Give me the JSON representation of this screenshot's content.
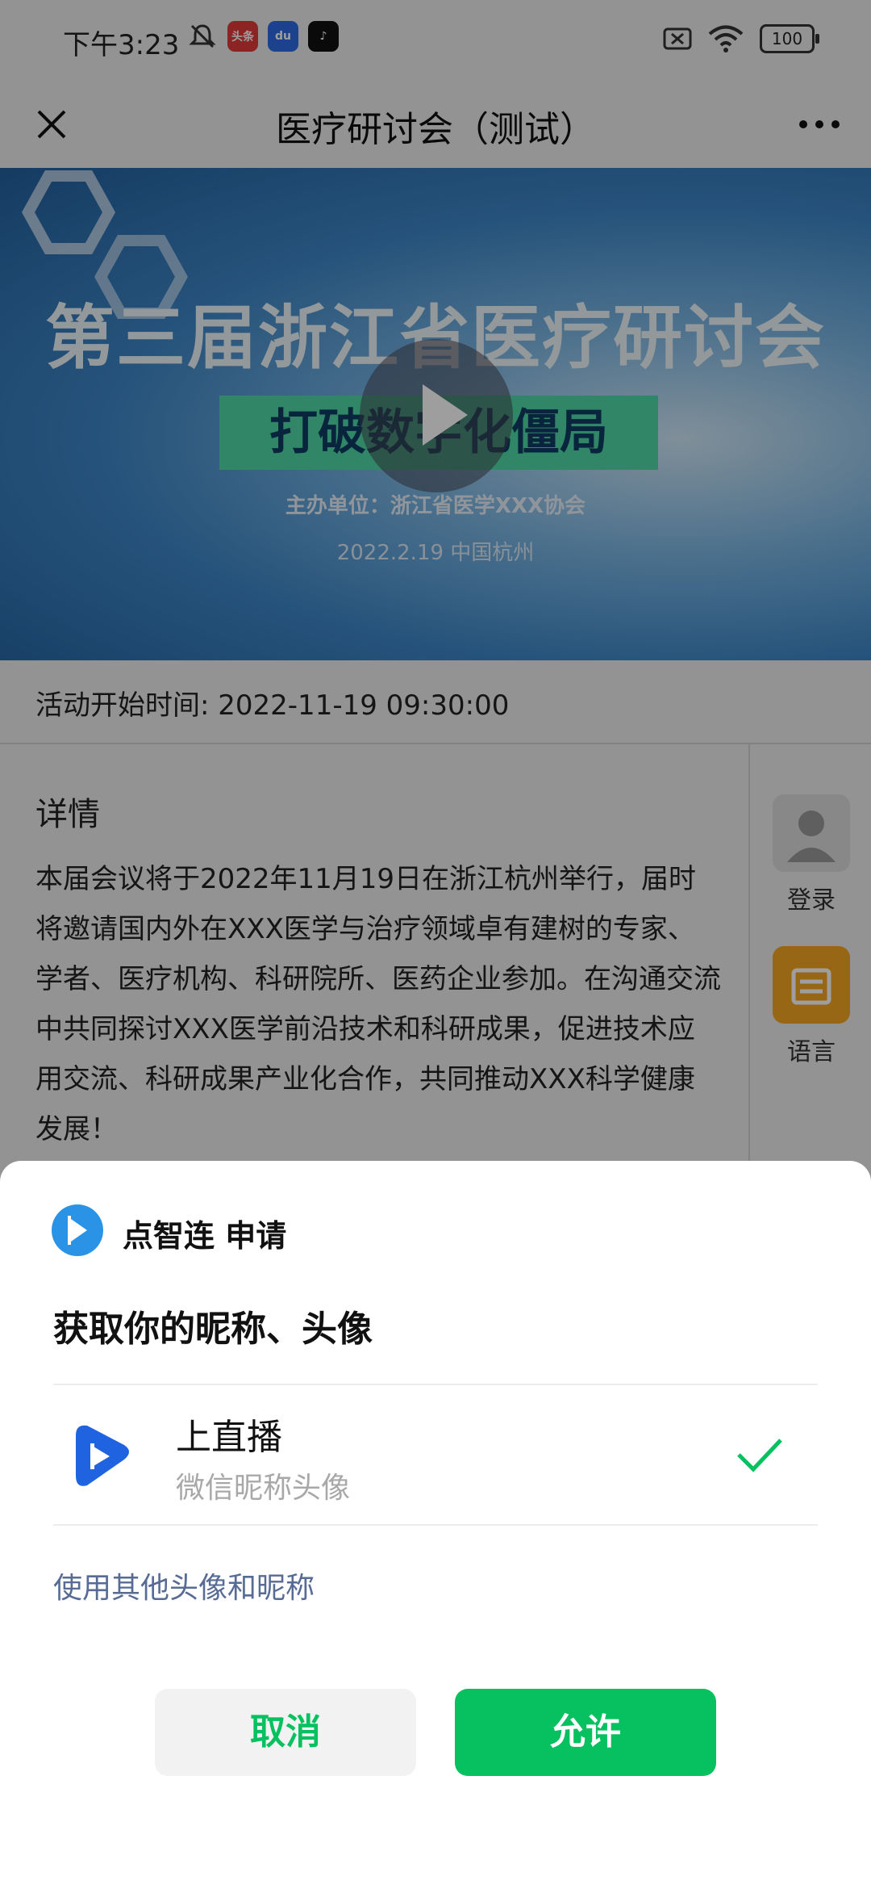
{
  "status_bar": {
    "time": "下午3:23",
    "battery": "100",
    "apps": [
      {
        "icon": "toutiao-icon",
        "label": "头条",
        "color": "#e23b3b"
      },
      {
        "icon": "baidu-icon",
        "label": "du",
        "color": "#2e6be6"
      },
      {
        "icon": "tiktok-icon",
        "label": "♪",
        "color": "#111111"
      }
    ]
  },
  "nav": {
    "title": "医疗研讨会（测试）"
  },
  "banner": {
    "title": "第三届浙江省医疗研讨会",
    "subtitle": "打破数字化僵局",
    "host": "主办单位：浙江省医学XXX协会",
    "date": "2022.2.19 中国杭州"
  },
  "event": {
    "start_time": "活动开始时间: 2022-11-19 09:30:00",
    "detail_heading": "详情",
    "detail_text": "本届会议将于2022年11月19日在浙江杭州举行，届时将邀请国内外在XXX医学与治疗领域卓有建树的专家、学者、医疗机构、科研院所、医药企业参加。在沟通交流中共同探讨XXX医学前沿技术和科研成果，促进技术应用交流、科研成果产业化合作，共同推动XXX科学健康发展！"
  },
  "side_menu": {
    "login_label": "登录",
    "language_label": "语言"
  },
  "auth_sheet": {
    "app_name": "点智连 申请",
    "title": "获取你的昵称、头像",
    "profile_name": "上直播",
    "profile_sub": "微信昵称头像",
    "other_option": "使用其他头像和昵称",
    "cancel_label": "取消",
    "allow_label": "允许"
  },
  "colors": {
    "accent_green": "#07c160",
    "link_blue": "#576b95",
    "brand_blue": "#2b93e6"
  }
}
